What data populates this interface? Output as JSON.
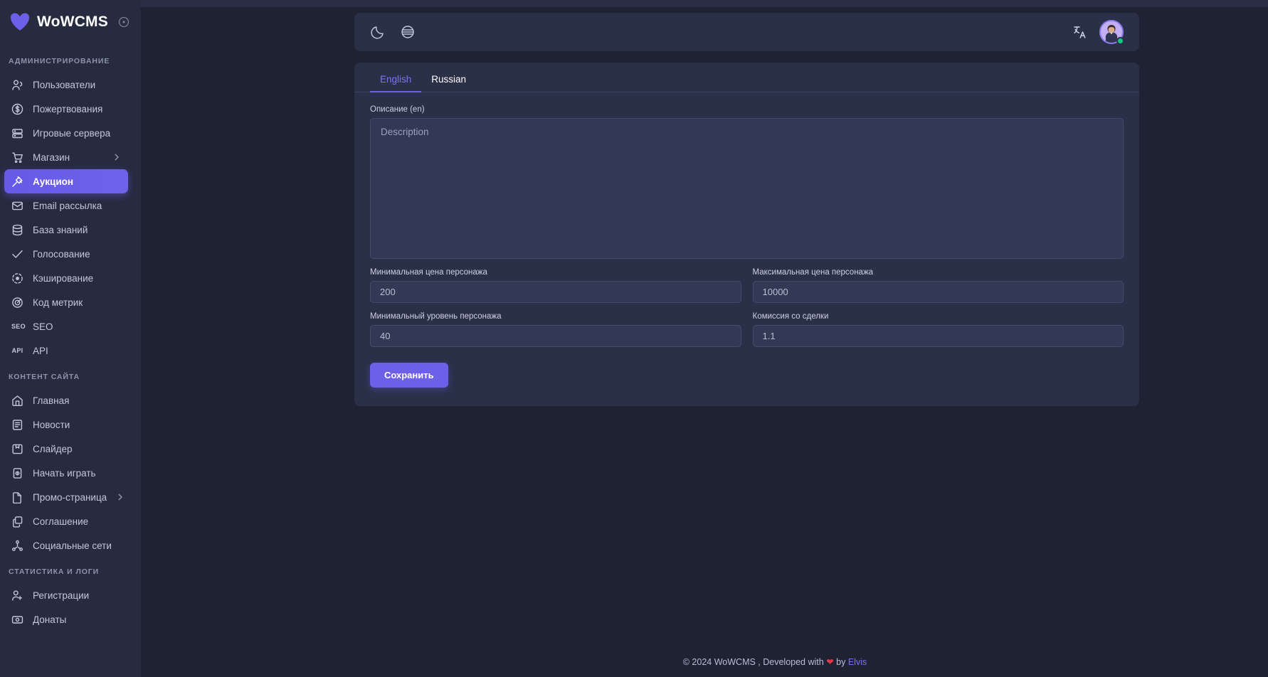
{
  "brand": {
    "name": "WoWCMS",
    "logo_icon": "heart-logo-icon",
    "collapse_icon": "circle-dot-icon"
  },
  "sidebar": {
    "sections": [
      {
        "title": "АДМИНИСТРИРОВАНИЕ",
        "items": [
          {
            "label": "Пользователи",
            "icon": "users-icon",
            "active": false,
            "chevron": false
          },
          {
            "label": "Пожертвования",
            "icon": "dollar-circle-icon",
            "active": false,
            "chevron": false
          },
          {
            "label": "Игровые сервера",
            "icon": "server-icon",
            "active": false,
            "chevron": false
          },
          {
            "label": "Магазин",
            "icon": "cart-icon",
            "active": false,
            "chevron": true
          },
          {
            "label": "Аукцион",
            "icon": "gavel-icon",
            "active": true,
            "chevron": false
          },
          {
            "label": "Email рассылка",
            "icon": "mail-icon",
            "active": false,
            "chevron": false
          },
          {
            "label": "База знаний",
            "icon": "database-icon",
            "active": false,
            "chevron": false
          },
          {
            "label": "Голосование",
            "icon": "check-icon",
            "active": false,
            "chevron": false
          },
          {
            "label": "Кэширование",
            "icon": "cache-icon",
            "active": false,
            "chevron": false
          },
          {
            "label": "Код метрик",
            "icon": "metrics-icon",
            "active": false,
            "chevron": false
          },
          {
            "label": "SEO",
            "icon": "seo-icon",
            "active": false,
            "chevron": false
          },
          {
            "label": "API",
            "icon": "api-icon",
            "active": false,
            "chevron": false
          }
        ]
      },
      {
        "title": "КОНТЕНТ САЙТА",
        "items": [
          {
            "label": "Главная",
            "icon": "home-icon",
            "active": false,
            "chevron": false
          },
          {
            "label": "Новости",
            "icon": "news-icon",
            "active": false,
            "chevron": false
          },
          {
            "label": "Слайдер",
            "icon": "slider-icon",
            "active": false,
            "chevron": false
          },
          {
            "label": "Начать играть",
            "icon": "play-card-icon",
            "active": false,
            "chevron": false
          },
          {
            "label": "Промо-страница",
            "icon": "file-icon",
            "active": false,
            "chevron": true
          },
          {
            "label": "Соглашение",
            "icon": "copy-icon",
            "active": false,
            "chevron": false
          },
          {
            "label": "Социальные сети",
            "icon": "share-icon",
            "active": false,
            "chevron": false
          }
        ]
      },
      {
        "title": "СТАТИСТИКА И ЛОГИ",
        "items": [
          {
            "label": "Регистрации",
            "icon": "user-plus-icon",
            "active": false,
            "chevron": false
          },
          {
            "label": "Донаты",
            "icon": "money-icon",
            "active": false,
            "chevron": false
          }
        ]
      }
    ]
  },
  "header": {
    "dark_mode_icon": "moon-icon",
    "language_globe_icon": "globe-icon",
    "translate_icon": "translate-icon",
    "avatar_icon": "user-avatar",
    "status": "online"
  },
  "tabs": [
    {
      "label": "English",
      "active": true
    },
    {
      "label": "Russian",
      "active": false
    }
  ],
  "form": {
    "description": {
      "label": "Описание (en)",
      "placeholder": "Description",
      "value": ""
    },
    "min_price": {
      "label": "Минимальная цена персонажа",
      "value": "200"
    },
    "max_price": {
      "label": "Максимальная цена персонажа",
      "value": "10000"
    },
    "min_level": {
      "label": "Минимальный уровень персонажа",
      "value": "40"
    },
    "commission": {
      "label": "Комиссия со сделки",
      "value": "1.1"
    },
    "save_label": "Сохранить"
  },
  "footer": {
    "copyright": "© 2024 WoWCMS , Developed with",
    "heart": "❤",
    "by": "by",
    "author": "Elvis"
  },
  "colors": {
    "accent": "#6c5fe8",
    "sidebar_bg": "#272b40",
    "main_bg": "#1f2233",
    "card_bg": "#2b3049",
    "input_bg": "#333855",
    "online": "#16c784",
    "heart": "#e0374a"
  }
}
